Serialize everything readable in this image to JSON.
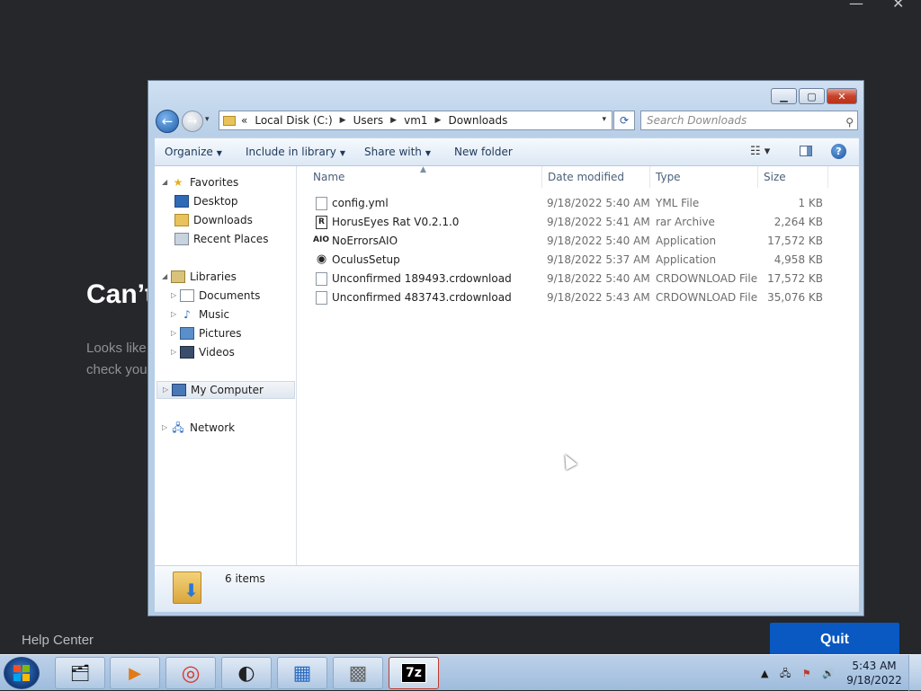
{
  "background_app": {
    "heading": "Can’t",
    "body_line1": "Looks like",
    "body_line2": "check you",
    "help_center": "Help Center",
    "quit_label": "Quit",
    "minimize_glyph": "—",
    "close_glyph": "✕"
  },
  "explorer": {
    "window_controls": {
      "minimize": "▁",
      "maximize": "▢",
      "close": "✕"
    },
    "nav": {
      "back_glyph": "←",
      "forward_glyph": "→",
      "history_glyph": "▾"
    },
    "address": {
      "overflow": "«",
      "crumbs": [
        "Local Disk (C:)",
        "Users",
        "vm1",
        "Downloads"
      ],
      "separator": "▶",
      "dropdown": "▾"
    },
    "refresh_glyph": "⟳",
    "search": {
      "placeholder": "Search Downloads",
      "icon": "⚲"
    },
    "toolbar": {
      "organize": "Organize",
      "include_in_library": "Include in library",
      "share_with": "Share with",
      "new_folder": "New folder",
      "caret": "▼",
      "views_glyph": "☷ ▾",
      "help_glyph": "?"
    },
    "navpane": {
      "favorites": "Favorites",
      "desktop": "Desktop",
      "downloads": "Downloads",
      "recent_places": "Recent Places",
      "libraries": "Libraries",
      "documents": "Documents",
      "music": "Music",
      "pictures": "Pictures",
      "videos": "Videos",
      "my_computer": "My Computer",
      "network": "Network",
      "expanded_glyph": "◢",
      "collapsed_glyph": "▷"
    },
    "columns": {
      "name": "Name",
      "date": "Date modified",
      "type": "Type",
      "size": "Size",
      "sort_glyph": "▲"
    },
    "files": [
      {
        "name": "config.yml",
        "date": "9/18/2022 5:40 AM",
        "type": "YML File",
        "size": "1 KB",
        "icon": ""
      },
      {
        "name": "HorusEyes Rat V0.2.1.0",
        "date": "9/18/2022 5:41 AM",
        "type": "rar Archive",
        "size": "2,264 KB",
        "icon": "R"
      },
      {
        "name": "NoErrorsAIO",
        "date": "9/18/2022 5:40 AM",
        "type": "Application",
        "size": "17,572 KB",
        "icon": "AIO"
      },
      {
        "name": "OculusSetup",
        "date": "9/18/2022 5:37 AM",
        "type": "Application",
        "size": "4,958 KB",
        "icon": "◉"
      },
      {
        "name": "Unconfirmed 189493.crdownload",
        "date": "9/18/2022 5:40 AM",
        "type": "CRDOWNLOAD File",
        "size": "17,572 KB",
        "icon": ""
      },
      {
        "name": "Unconfirmed 483743.crdownload",
        "date": "9/18/2022 5:43 AM",
        "type": "CRDOWNLOAD File",
        "size": "35,076 KB",
        "icon": ""
      }
    ],
    "details": {
      "count": "6 items",
      "icon_glyph": "⬇"
    }
  },
  "taskbar": {
    "apps": [
      {
        "name": "explorer",
        "glyph": "🗂"
      },
      {
        "name": "media-player",
        "glyph": "▶"
      },
      {
        "name": "chrome",
        "glyph": "◎"
      },
      {
        "name": "app",
        "glyph": "◐"
      },
      {
        "name": "control-panel",
        "glyph": "▦"
      },
      {
        "name": "bricks",
        "glyph": "▩"
      },
      {
        "name": "7zip",
        "glyph": "7z"
      }
    ],
    "tray": {
      "arrow": "▲",
      "network": "🖧",
      "flag": "⚑",
      "volume": "🔊"
    },
    "clock": {
      "time": "5:43 AM",
      "date": "9/18/2022"
    }
  }
}
